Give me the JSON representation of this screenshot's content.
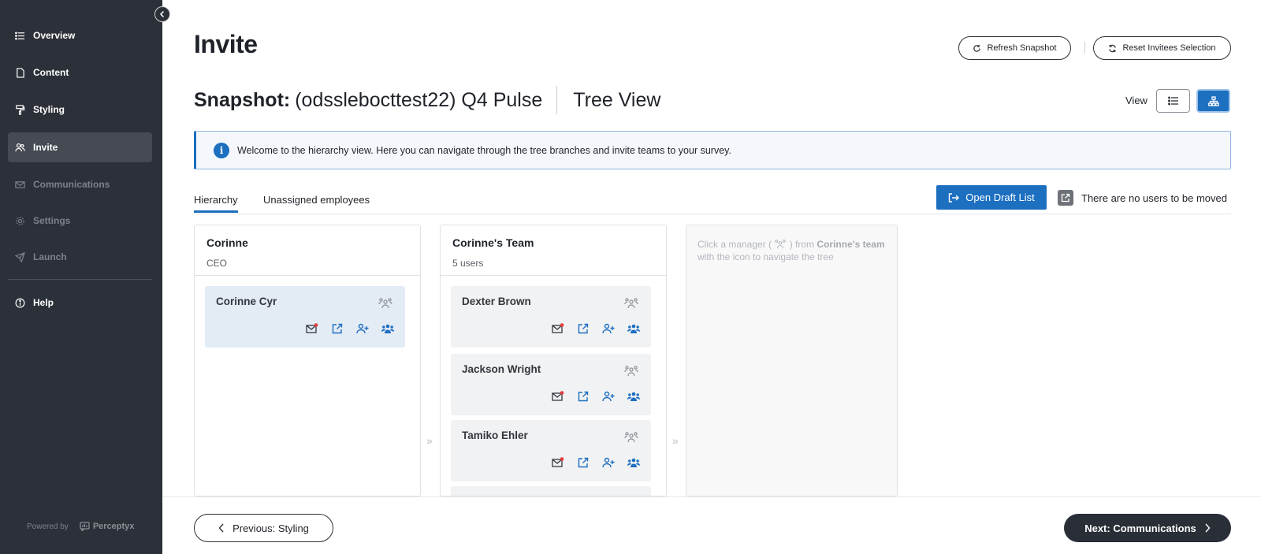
{
  "sidebar": {
    "items": [
      {
        "label": "Overview",
        "icon": "list-icon"
      },
      {
        "label": "Content",
        "icon": "document-icon"
      },
      {
        "label": "Styling",
        "icon": "paint-roller-icon"
      },
      {
        "label": "Invite",
        "icon": "users-icon"
      },
      {
        "label": "Communications",
        "icon": "mail-icon"
      },
      {
        "label": "Settings",
        "icon": "gear-icon"
      },
      {
        "label": "Launch",
        "icon": "rocket-icon"
      },
      {
        "label": "Help",
        "icon": "info-icon"
      }
    ],
    "active": "Invite",
    "powered_by": "Powered by",
    "brand": "Perceptyx"
  },
  "header": {
    "title": "Invite",
    "refresh_label": "Refresh Snapshot",
    "reset_label": "Reset Invitees Selection"
  },
  "snapshot": {
    "label": "Snapshot:",
    "name": "(odsslebocttest22) Q4 Pulse",
    "view_name": "Tree View"
  },
  "view_toggle": {
    "label": "View",
    "active": "tree"
  },
  "banner": {
    "icon": "i",
    "text": "Welcome to the hierarchy view. Here you can navigate through the tree branches and invite teams to your survey."
  },
  "tabs": [
    {
      "label": "Hierarchy",
      "active": true
    },
    {
      "label": "Unassigned employees",
      "active": false
    }
  ],
  "draft": {
    "button_label": "Open Draft List",
    "moved_text": "There are no users to be moved"
  },
  "columns": {
    "first": {
      "title": "Corinne",
      "subtitle": "CEO",
      "cards": [
        {
          "name": "Corinne Cyr"
        }
      ]
    },
    "second": {
      "title": "Corinne's Team",
      "subtitle": "5 users",
      "cards": [
        {
          "name": "Dexter Brown"
        },
        {
          "name": "Jackson Wright"
        },
        {
          "name": "Tamiko Ehler"
        }
      ]
    },
    "third": {
      "hint_prefix": "Click a manager (",
      "hint_mid": ") from",
      "hint_bold": "Corinne's team",
      "hint_suffix": "with the icon to navigate the tree"
    },
    "separator": "»"
  },
  "footer": {
    "prev_label": "Previous: Styling",
    "next_label": "Next: Communications"
  },
  "colors": {
    "sidebar_bg": "#2c3038",
    "accent": "#1d6fc0",
    "notification_dot": "#e23a3a"
  }
}
